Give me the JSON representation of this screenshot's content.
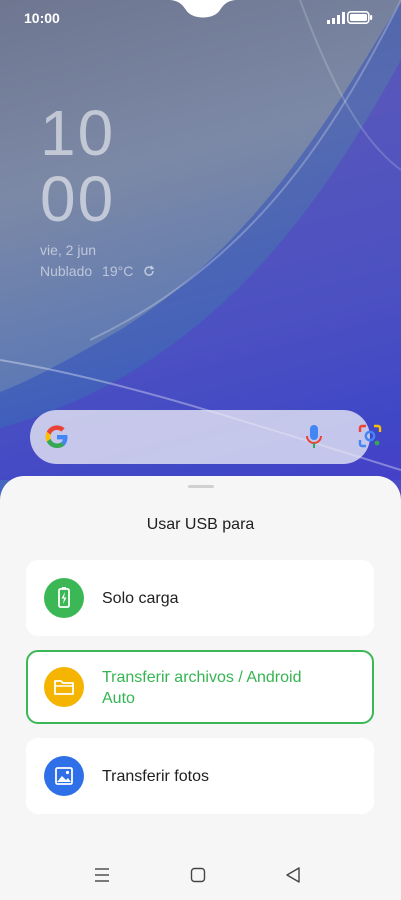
{
  "status_bar": {
    "time": "10:00"
  },
  "lockscreen": {
    "clock_hour": "10",
    "clock_minute": "00",
    "date": "vie, 2 jun",
    "weather_condition": "Nublado",
    "weather_temp": "19°C"
  },
  "search_bar": {
    "logo": "google-logo",
    "mic_icon": "mic-icon",
    "lens_icon": "lens-icon"
  },
  "usb_sheet": {
    "title": "Usar USB para",
    "options": [
      {
        "label": "Solo carga",
        "icon": "battery-charging-icon",
        "icon_color": "#3bb855",
        "selected": false
      },
      {
        "label_line1": "Transferir archivos / Android",
        "label_line2": "Auto",
        "icon": "folder-icon",
        "icon_color": "#f4b400",
        "selected": true
      },
      {
        "label": "Transferir fotos",
        "icon": "image-icon",
        "icon_color": "#2f6fe8",
        "selected": false
      }
    ]
  },
  "colors": {
    "accent": "#3bb855",
    "sheet_bg": "#f6f6f6"
  },
  "nav_bar": {
    "buttons": [
      "menu-icon",
      "home-icon",
      "back-icon"
    ]
  }
}
